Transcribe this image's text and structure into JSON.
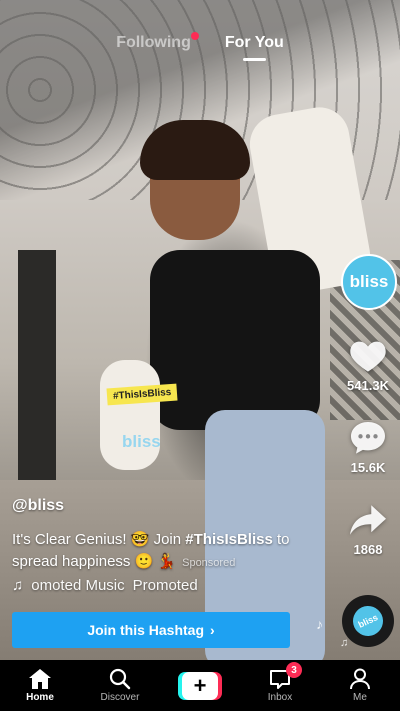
{
  "top_tabs": {
    "following": "Following",
    "for_you": "For You"
  },
  "creator": {
    "avatar_text": "bliss",
    "handle": "@bliss"
  },
  "actions": {
    "likes": "541.3K",
    "comments": "15.6K",
    "shares": "1868"
  },
  "caption": {
    "text_start": "It's Clear Genius! 🤓 Join ",
    "hashtag": "#ThisIsBliss",
    "text_end": " to spread happiness 🙂 💃",
    "sponsored": "Sponsored"
  },
  "music": {
    "scrolling_text": "omoted Music",
    "promoted": "Promoted",
    "disc_text": "bliss"
  },
  "stickers": {
    "tag": "#ThisIsBliss",
    "watermark": "bliss"
  },
  "join_button": {
    "label": "Join this Hashtag",
    "chevron": "›"
  },
  "bottom_nav": {
    "home": "Home",
    "discover": "Discover",
    "create": "+",
    "inbox": "Inbox",
    "inbox_badge": "3",
    "me": "Me"
  },
  "colors": {
    "accent_red": "#fe2c55",
    "accent_cyan": "#25f4ee",
    "join_blue": "#1ea1f2",
    "brand_blue": "#52c3e8"
  }
}
